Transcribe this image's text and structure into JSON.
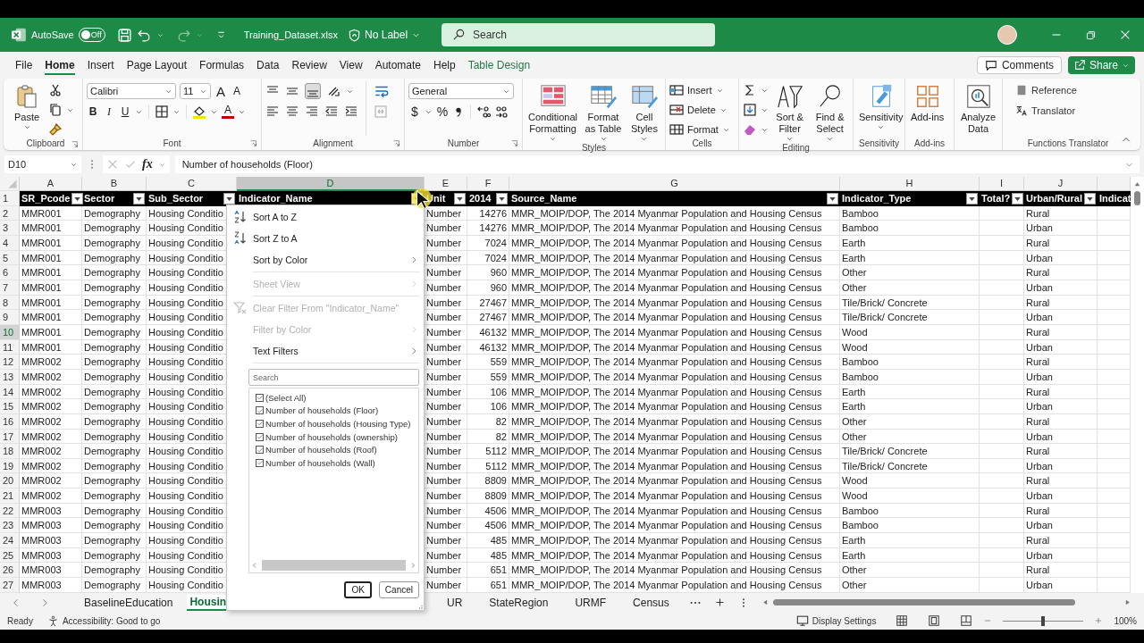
{
  "title_bar": {
    "autosave_label": "AutoSave",
    "autosave": {
      "label": "Off",
      "on": false
    },
    "file_name": "Training_Dataset.xlsx",
    "sensitivity_label": "No Label",
    "search": {
      "placeholder": "Search"
    }
  },
  "menu_tabs": [
    {
      "label": "File",
      "selected": false,
      "kind": "standard"
    },
    {
      "label": "Home",
      "selected": true,
      "kind": "standard"
    },
    {
      "label": "Insert",
      "selected": false,
      "kind": "standard"
    },
    {
      "label": "Page Layout",
      "selected": false,
      "kind": "standard"
    },
    {
      "label": "Formulas",
      "selected": false,
      "kind": "standard"
    },
    {
      "label": "Data",
      "selected": false,
      "kind": "standard"
    },
    {
      "label": "Review",
      "selected": false,
      "kind": "standard"
    },
    {
      "label": "View",
      "selected": false,
      "kind": "standard"
    },
    {
      "label": "Automate",
      "selected": false,
      "kind": "standard"
    },
    {
      "label": "Help",
      "selected": false,
      "kind": "standard"
    },
    {
      "label": "Table Design",
      "selected": false,
      "kind": "contextual"
    }
  ],
  "actions": {
    "comments": "Comments",
    "share": "Share"
  },
  "ribbon": {
    "clipboard": {
      "name": "Clipboard",
      "paste": "Paste"
    },
    "font": {
      "name": "Font",
      "font_family": "Calibri",
      "font_size": "11",
      "grow": "A",
      "shrink": "A",
      "bold": "B",
      "italic": "I",
      "underline": "U",
      "font_color": "A"
    },
    "alignment": {
      "name": "Alignment"
    },
    "number": {
      "name": "Number",
      "format": "General",
      "currency": "$",
      "percent": "%"
    },
    "styles": {
      "name": "Styles",
      "buttons": [
        "Conditional Formatting",
        "Format as Table",
        "Cell Styles"
      ]
    },
    "cells": {
      "name": "Cells",
      "buttons": [
        "Insert",
        "Delete",
        "Format"
      ]
    },
    "editing": {
      "name": "Editing",
      "buttons": [
        "Sort & Filter",
        "Find & Select"
      ]
    },
    "sensitivity": {
      "name": "Sensitivity",
      "button": "Sensitivity"
    },
    "addins": {
      "name": "Add-ins",
      "buttons": [
        "Add-ins",
        "Analyze Data"
      ]
    },
    "functions_translator": {
      "name": "Functions Translator",
      "buttons": [
        "Reference",
        "Translator"
      ]
    }
  },
  "formula_bar": {
    "cell_ref": "D10",
    "fx": "fx",
    "formula": "Number of households (Floor)"
  },
  "sheet": {
    "header_row_number": "1",
    "columns": [
      {
        "letter": "A",
        "header": "SR_Pcode",
        "selected": false,
        "filter_button": true
      },
      {
        "letter": "B",
        "header": "Sector",
        "selected": false,
        "filter_button": true
      },
      {
        "letter": "C",
        "header": "Sub_Sector",
        "selected": false,
        "filter_button": true
      },
      {
        "letter": "D",
        "header": "Indicator_Name",
        "selected": true,
        "filter_button": true
      },
      {
        "letter": "E",
        "header": "Unit",
        "selected": false,
        "filter_button": true
      },
      {
        "letter": "F",
        "header": "2014",
        "selected": false,
        "filter_button": true
      },
      {
        "letter": "G",
        "header": "Source_Name",
        "selected": false,
        "filter_button": true
      },
      {
        "letter": "H",
        "header": "Indicator_Type",
        "selected": false,
        "filter_button": true
      },
      {
        "letter": "I",
        "header": "Total?",
        "selected": false,
        "filter_button": true
      },
      {
        "letter": "J",
        "header": "Urban/Rural",
        "selected": false,
        "filter_button": true
      },
      {
        "header": "Indicat",
        "selected": false,
        "filter_button": false
      }
    ],
    "rows": [
      {
        "number": "2",
        "selected": false,
        "cells": {
          "A": "MMR001",
          "B": "Demography",
          "C": "Housing Conditio",
          "E": "Number",
          "F": "14276",
          "G": "MMR_MOIP/DOP, The 2014 Myanmar Population and Housing Census",
          "H": "Bamboo",
          "J": "Rural"
        }
      },
      {
        "number": "3",
        "selected": false,
        "cells": {
          "A": "MMR001",
          "B": "Demography",
          "C": "Housing Conditio",
          "E": "Number",
          "F": "14276",
          "G": "MMR_MOIP/DOP, The 2014 Myanmar Population and Housing Census",
          "H": "Bamboo",
          "J": "Urban"
        }
      },
      {
        "number": "4",
        "selected": false,
        "cells": {
          "A": "MMR001",
          "B": "Demography",
          "C": "Housing Conditio",
          "E": "Number",
          "F": "7024",
          "G": "MMR_MOIP/DOP, The 2014 Myanmar Population and Housing Census",
          "H": "Earth",
          "J": "Rural"
        }
      },
      {
        "number": "5",
        "selected": false,
        "cells": {
          "A": "MMR001",
          "B": "Demography",
          "C": "Housing Conditio",
          "E": "Number",
          "F": "7024",
          "G": "MMR_MOIP/DOP, The 2014 Myanmar Population and Housing Census",
          "H": "Earth",
          "J": "Urban"
        }
      },
      {
        "number": "6",
        "selected": false,
        "cells": {
          "A": "MMR001",
          "B": "Demography",
          "C": "Housing Conditio",
          "E": "Number",
          "F": "960",
          "G": "MMR_MOIP/DOP, The 2014 Myanmar Population and Housing Census",
          "H": "Other",
          "J": "Rural"
        }
      },
      {
        "number": "7",
        "selected": false,
        "cells": {
          "A": "MMR001",
          "B": "Demography",
          "C": "Housing Conditio",
          "E": "Number",
          "F": "960",
          "G": "MMR_MOIP/DOP, The 2014 Myanmar Population and Housing Census",
          "H": "Other",
          "J": "Urban"
        }
      },
      {
        "number": "8",
        "selected": false,
        "cells": {
          "A": "MMR001",
          "B": "Demography",
          "C": "Housing Conditio",
          "E": "Number",
          "F": "27467",
          "G": "MMR_MOIP/DOP, The 2014 Myanmar Population and Housing Census",
          "H": "Tile/Brick/ Concrete",
          "J": "Rural"
        }
      },
      {
        "number": "9",
        "selected": false,
        "cells": {
          "A": "MMR001",
          "B": "Demography",
          "C": "Housing Conditio",
          "E": "Number",
          "F": "27467",
          "G": "MMR_MOIP/DOP, The 2014 Myanmar Population and Housing Census",
          "H": "Tile/Brick/ Concrete",
          "J": "Urban"
        }
      },
      {
        "number": "10",
        "selected": true,
        "cells": {
          "A": "MMR001",
          "B": "Demography",
          "C": "Housing Conditio",
          "E": "Number",
          "F": "46132",
          "G": "MMR_MOIP/DOP, The 2014 Myanmar Population and Housing Census",
          "H": "Wood",
          "J": "Rural"
        }
      },
      {
        "number": "11",
        "selected": false,
        "cells": {
          "A": "MMR001",
          "B": "Demography",
          "C": "Housing Conditio",
          "E": "Number",
          "F": "46132",
          "G": "MMR_MOIP/DOP, The 2014 Myanmar Population and Housing Census",
          "H": "Wood",
          "J": "Urban"
        }
      },
      {
        "number": "12",
        "selected": false,
        "cells": {
          "A": "MMR002",
          "B": "Demography",
          "C": "Housing Conditio",
          "E": "Number",
          "F": "559",
          "G": "MMR_MOIP/DOP, The 2014 Myanmar Population and Housing Census",
          "H": "Bamboo",
          "J": "Rural"
        }
      },
      {
        "number": "13",
        "selected": false,
        "cells": {
          "A": "MMR002",
          "B": "Demography",
          "C": "Housing Conditio",
          "E": "Number",
          "F": "559",
          "G": "MMR_MOIP/DOP, The 2014 Myanmar Population and Housing Census",
          "H": "Bamboo",
          "J": "Urban"
        }
      },
      {
        "number": "14",
        "selected": false,
        "cells": {
          "A": "MMR002",
          "B": "Demography",
          "C": "Housing Conditio",
          "E": "Number",
          "F": "106",
          "G": "MMR_MOIP/DOP, The 2014 Myanmar Population and Housing Census",
          "H": "Earth",
          "J": "Rural"
        }
      },
      {
        "number": "15",
        "selected": false,
        "cells": {
          "A": "MMR002",
          "B": "Demography",
          "C": "Housing Conditio",
          "E": "Number",
          "F": "106",
          "G": "MMR_MOIP/DOP, The 2014 Myanmar Population and Housing Census",
          "H": "Earth",
          "J": "Urban"
        }
      },
      {
        "number": "16",
        "selected": false,
        "cells": {
          "A": "MMR002",
          "B": "Demography",
          "C": "Housing Conditio",
          "E": "Number",
          "F": "82",
          "G": "MMR_MOIP/DOP, The 2014 Myanmar Population and Housing Census",
          "H": "Other",
          "J": "Rural"
        }
      },
      {
        "number": "17",
        "selected": false,
        "cells": {
          "A": "MMR002",
          "B": "Demography",
          "C": "Housing Conditio",
          "E": "Number",
          "F": "82",
          "G": "MMR_MOIP/DOP, The 2014 Myanmar Population and Housing Census",
          "H": "Other",
          "J": "Urban"
        }
      },
      {
        "number": "18",
        "selected": false,
        "cells": {
          "A": "MMR002",
          "B": "Demography",
          "C": "Housing Conditio",
          "E": "Number",
          "F": "5112",
          "G": "MMR_MOIP/DOP, The 2014 Myanmar Population and Housing Census",
          "H": "Tile/Brick/ Concrete",
          "J": "Rural"
        }
      },
      {
        "number": "19",
        "selected": false,
        "cells": {
          "A": "MMR002",
          "B": "Demography",
          "C": "Housing Conditio",
          "E": "Number",
          "F": "5112",
          "G": "MMR_MOIP/DOP, The 2014 Myanmar Population and Housing Census",
          "H": "Tile/Brick/ Concrete",
          "J": "Urban"
        }
      },
      {
        "number": "20",
        "selected": false,
        "cells": {
          "A": "MMR002",
          "B": "Demography",
          "C": "Housing Conditio",
          "E": "Number",
          "F": "8809",
          "G": "MMR_MOIP/DOP, The 2014 Myanmar Population and Housing Census",
          "H": "Wood",
          "J": "Rural"
        }
      },
      {
        "number": "21",
        "selected": false,
        "cells": {
          "A": "MMR002",
          "B": "Demography",
          "C": "Housing Conditio",
          "E": "Number",
          "F": "8809",
          "G": "MMR_MOIP/DOP, The 2014 Myanmar Population and Housing Census",
          "H": "Wood",
          "J": "Urban"
        }
      },
      {
        "number": "22",
        "selected": false,
        "cells": {
          "A": "MMR003",
          "B": "Demography",
          "C": "Housing Conditio",
          "E": "Number",
          "F": "4506",
          "G": "MMR_MOIP/DOP, The 2014 Myanmar Population and Housing Census",
          "H": "Bamboo",
          "J": "Rural"
        }
      },
      {
        "number": "23",
        "selected": false,
        "cells": {
          "A": "MMR003",
          "B": "Demography",
          "C": "Housing Conditio",
          "E": "Number",
          "F": "4506",
          "G": "MMR_MOIP/DOP, The 2014 Myanmar Population and Housing Census",
          "H": "Bamboo",
          "J": "Urban"
        }
      },
      {
        "number": "24",
        "selected": false,
        "cells": {
          "A": "MMR003",
          "B": "Demography",
          "C": "Housing Conditio",
          "E": "Number",
          "F": "485",
          "G": "MMR_MOIP/DOP, The 2014 Myanmar Population and Housing Census",
          "H": "Earth",
          "J": "Rural"
        }
      },
      {
        "number": "25",
        "selected": false,
        "cells": {
          "A": "MMR003",
          "B": "Demography",
          "C": "Housing Conditio",
          "E": "Number",
          "F": "485",
          "G": "MMR_MOIP/DOP, The 2014 Myanmar Population and Housing Census",
          "H": "Earth",
          "J": "Urban"
        }
      },
      {
        "number": "26",
        "selected": false,
        "cells": {
          "A": "MMR003",
          "B": "Demography",
          "C": "Housing Conditio",
          "E": "Number",
          "F": "651",
          "G": "MMR_MOIP/DOP, The 2014 Myanmar Population and Housing Census",
          "H": "Other",
          "J": "Rural"
        }
      },
      {
        "number": "27",
        "selected": false,
        "cells": {
          "A": "MMR003",
          "B": "Demography",
          "C": "Housing Conditio",
          "E": "Number",
          "F": "651",
          "G": "MMR_MOIP/DOP, The 2014 Myanmar Population and Housing Census",
          "H": "Other",
          "J": "Urban"
        }
      }
    ]
  },
  "filter_menu": {
    "items": [
      {
        "label": "Sort A to Z",
        "kind": "sort-az",
        "disabled": false
      },
      {
        "label": "Sort Z to A",
        "kind": "sort-za",
        "disabled": false
      },
      {
        "label": "Sort by Color",
        "kind": "submenu",
        "disabled": false
      },
      {
        "label": "Sheet View",
        "kind": "submenu",
        "disabled": true
      },
      {
        "label": "Clear Filter From \"Indicator_Name\"",
        "kind": "clear-filter",
        "disabled": true
      },
      {
        "label": "Filter by Color",
        "kind": "submenu",
        "disabled": true
      },
      {
        "label": "Text Filters",
        "kind": "submenu",
        "disabled": false
      }
    ],
    "search": {
      "placeholder": "Search"
    },
    "values": [
      {
        "label": "(Select All)",
        "checked": true
      },
      {
        "label": "Number of households (Floor)",
        "checked": true
      },
      {
        "label": "Number of households (Housing Type)",
        "checked": true
      },
      {
        "label": "Number of households (ownership)",
        "checked": true
      },
      {
        "label": "Number of households (Roof)",
        "checked": true
      },
      {
        "label": "Number of households (Wall)",
        "checked": true
      }
    ],
    "ok": "OK",
    "cancel": "Cancel"
  },
  "sheet_tabs": [
    {
      "label": "BaselineEducation",
      "selected": false
    },
    {
      "label": "Housin",
      "selected": true
    },
    {
      "label": "UR",
      "selected": false
    },
    {
      "label": "StateRegion",
      "selected": false
    },
    {
      "label": "URMF",
      "selected": false
    },
    {
      "label": "Census",
      "selected": false
    }
  ],
  "status_bar": {
    "status": "Ready",
    "accessibility": "Accessibility: Good to go",
    "display_settings": "Display Settings",
    "zoom": {
      "level": 0.5,
      "reading": "100%"
    }
  }
}
